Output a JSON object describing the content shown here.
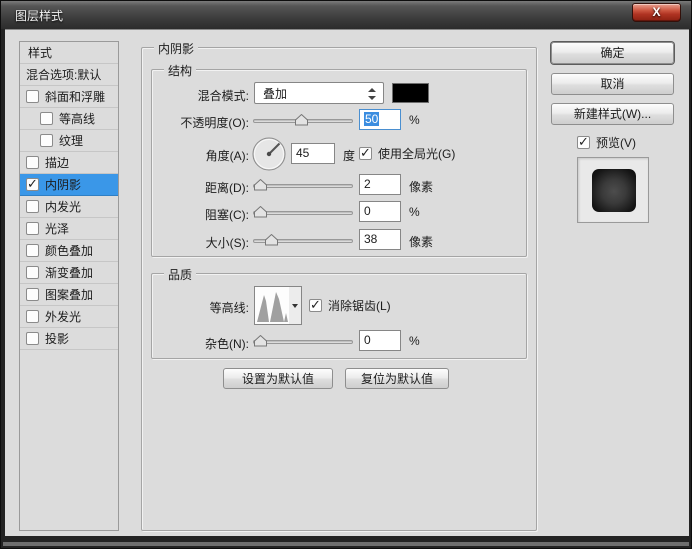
{
  "window": {
    "title": "图层样式",
    "close": "X"
  },
  "sidebar": {
    "header": "样式",
    "items": [
      {
        "label": "混合选项:默认",
        "checkbox": false,
        "checked": false,
        "selected": false
      },
      {
        "label": "斜面和浮雕",
        "checkbox": true,
        "checked": false,
        "selected": false
      },
      {
        "label": "等高线",
        "checkbox": true,
        "checked": false,
        "selected": false,
        "indent": true
      },
      {
        "label": "纹理",
        "checkbox": true,
        "checked": false,
        "selected": false,
        "indent": true
      },
      {
        "label": "描边",
        "checkbox": true,
        "checked": false,
        "selected": false
      },
      {
        "label": "内阴影",
        "checkbox": true,
        "checked": true,
        "selected": true
      },
      {
        "label": "内发光",
        "checkbox": true,
        "checked": false,
        "selected": false
      },
      {
        "label": "光泽",
        "checkbox": true,
        "checked": false,
        "selected": false
      },
      {
        "label": "颜色叠加",
        "checkbox": true,
        "checked": false,
        "selected": false
      },
      {
        "label": "渐变叠加",
        "checkbox": true,
        "checked": false,
        "selected": false
      },
      {
        "label": "图案叠加",
        "checkbox": true,
        "checked": false,
        "selected": false
      },
      {
        "label": "外发光",
        "checkbox": true,
        "checked": false,
        "selected": false
      },
      {
        "label": "投影",
        "checkbox": true,
        "checked": false,
        "selected": false
      }
    ]
  },
  "panel": {
    "title": "内阴影",
    "structure": {
      "title": "结构",
      "blend_mode": {
        "label": "混合模式:",
        "value": "叠加",
        "swatch_color": "#000000"
      },
      "opacity": {
        "label": "不透明度(O):",
        "value": "50",
        "unit": "%",
        "selected": true
      },
      "angle": {
        "label": "角度(A):",
        "value": "45",
        "unit": "度",
        "degrees": 45
      },
      "global_light": {
        "label": "使用全局光(G)",
        "checked": true
      },
      "distance": {
        "label": "距离(D):",
        "value": "2",
        "unit": "像素"
      },
      "choke": {
        "label": "阻塞(C):",
        "value": "0",
        "unit": "%"
      },
      "size": {
        "label": "大小(S):",
        "value": "38",
        "unit": "像素"
      }
    },
    "quality": {
      "title": "品质",
      "contour": {
        "label": "等高线:"
      },
      "antialias": {
        "label": "消除锯齿(L)",
        "checked": true
      },
      "noise": {
        "label": "杂色(N):",
        "value": "0",
        "unit": "%"
      }
    },
    "bottom_buttons": {
      "make_default": "设置为默认值",
      "reset_default": "复位为默认值"
    }
  },
  "actions": {
    "ok": "确定",
    "cancel": "取消",
    "new_style": "新建样式(W)...",
    "preview": {
      "label": "预览(V)",
      "checked": true
    }
  },
  "colors": {
    "selection_blue": "#3a97e8",
    "field_selection_blue": "#3b8de0",
    "swatch_black": "#000000",
    "close_button_red": "#b03322",
    "dialog_bg": "#dcdcdc"
  }
}
